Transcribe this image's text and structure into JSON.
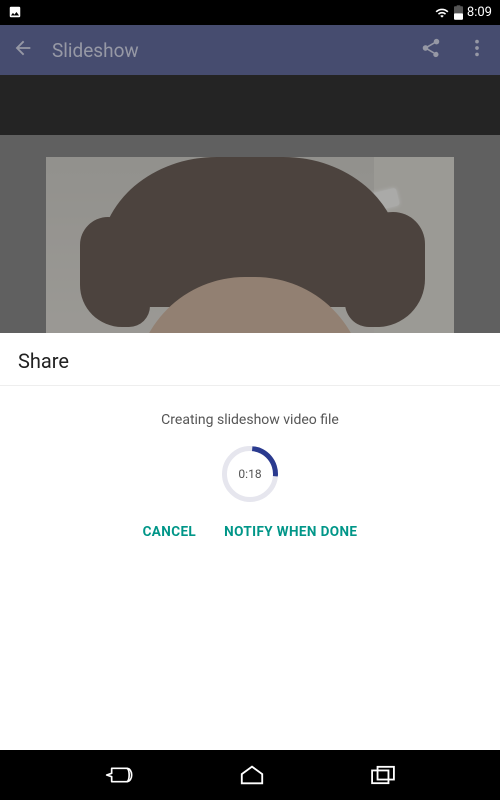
{
  "status_bar": {
    "time": "8:09"
  },
  "action_bar": {
    "title": "Slideshow"
  },
  "sheet": {
    "title": "Share",
    "progress_message": "Creating slideshow video file",
    "progress_time": "0:18",
    "cancel_label": "CANCEL",
    "notify_label": "NOTIFY WHEN DONE"
  }
}
